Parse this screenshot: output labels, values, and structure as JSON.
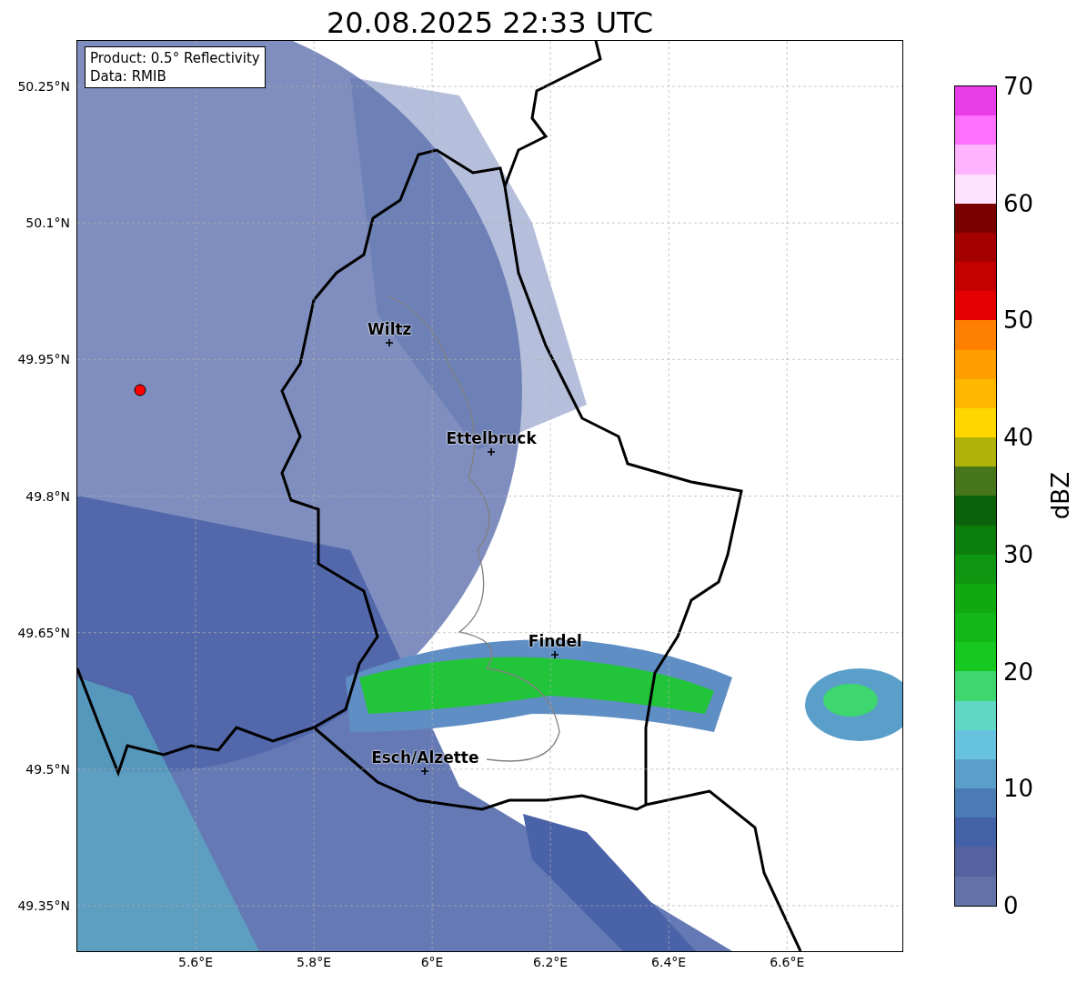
{
  "title": "20.08.2025 22:33 UTC",
  "info_box": {
    "lines": [
      "Product: 0.5° Reflectivity",
      "Data: RMIB"
    ]
  },
  "map": {
    "cities": [
      {
        "name": "Wiltz"
      },
      {
        "name": "Ettelbruck"
      },
      {
        "name": "Findel"
      },
      {
        "name": "Esch/Alzette"
      }
    ],
    "yticks": [
      "50.25°N",
      "50.1°N",
      "49.95°N",
      "49.8°N",
      "49.65°N",
      "49.5°N",
      "49.35°N"
    ],
    "xticks": [
      "5.6°E",
      "5.8°E",
      "6°E",
      "6.2°E",
      "6.4°E",
      "6.6°E"
    ]
  },
  "colorbar": {
    "label": "dBZ",
    "ticks": [
      "70",
      "60",
      "50",
      "40",
      "30",
      "20",
      "10",
      "0"
    ],
    "bands": [
      {
        "color": "#6272a8"
      },
      {
        "color": "#54639f"
      },
      {
        "color": "#4261a6"
      },
      {
        "color": "#4a7bb5"
      },
      {
        "color": "#5a9fc9"
      },
      {
        "color": "#66c2de"
      },
      {
        "color": "#5fd7c4"
      },
      {
        "color": "#3dd66f"
      },
      {
        "color": "#17c91e"
      },
      {
        "color": "#12b818"
      },
      {
        "color": "#10a910"
      },
      {
        "color": "#0f9610"
      },
      {
        "color": "#0c7e0c"
      },
      {
        "color": "#0a620a"
      },
      {
        "color": "#47761a"
      },
      {
        "color": "#b0b20a"
      },
      {
        "color": "#ffd700"
      },
      {
        "color": "#ffb700"
      },
      {
        "color": "#ff9e00"
      },
      {
        "color": "#ff7f00"
      },
      {
        "color": "#e40000"
      },
      {
        "color": "#c40000"
      },
      {
        "color": "#a40000"
      },
      {
        "color": "#7a0000"
      },
      {
        "color": "#ffe2ff"
      },
      {
        "color": "#ffb4ff"
      },
      {
        "color": "#ff70ff"
      },
      {
        "color": "#e83ce8"
      }
    ]
  }
}
